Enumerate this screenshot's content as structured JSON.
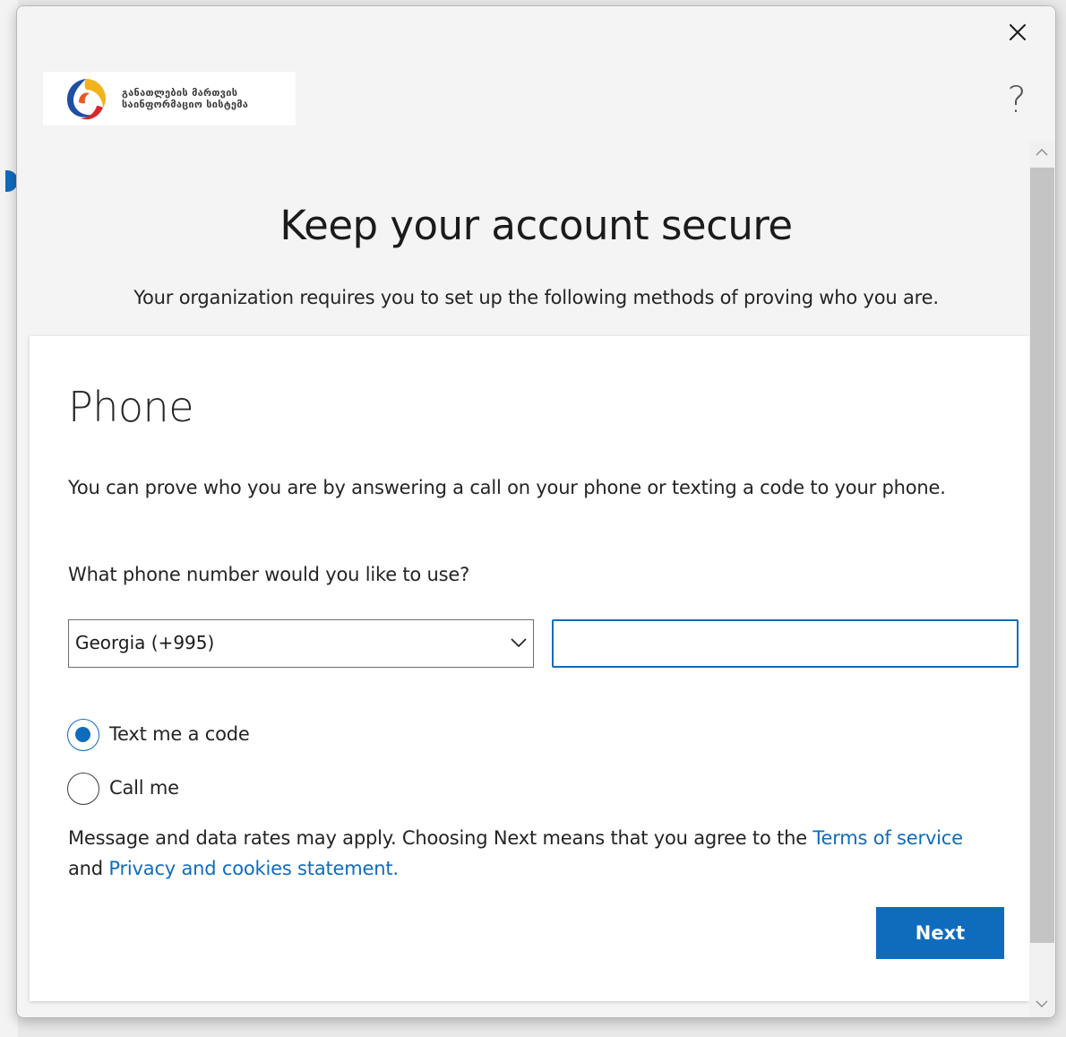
{
  "logo": {
    "line1": "განათლების მართვის",
    "line2": "საინფორმაციო სისტემა"
  },
  "window": {
    "help_label": "?"
  },
  "header": {
    "title": "Keep your account secure",
    "subtitle": "Your organization requires you to set up the following methods of proving who you are."
  },
  "card": {
    "title": "Phone",
    "description": "You can prove who you are by answering a call on your phone or texting a code to your phone.",
    "question": "What phone number would you like to use?",
    "country_select": {
      "value": "Georgia (+995)"
    },
    "phone_input": {
      "value": "",
      "placeholder": ""
    },
    "options": [
      {
        "label": "Text me a code",
        "checked": true
      },
      {
        "label": "Call me",
        "checked": false
      }
    ],
    "terms": {
      "prefix": "Message and data rates may apply. Choosing Next means that you agree to the ",
      "terms_link": "Terms of service",
      "middle": " and ",
      "privacy_link": "Privacy and cookies statement."
    },
    "next_label": "Next"
  },
  "colors": {
    "accent": "#0f6cbd",
    "text": "#242424"
  },
  "icons": {
    "close": "close-icon",
    "help": "help-icon",
    "dropdown": "chevron-down-icon",
    "scroll_up": "chevron-up-icon",
    "scroll_down": "chevron-down-icon"
  }
}
